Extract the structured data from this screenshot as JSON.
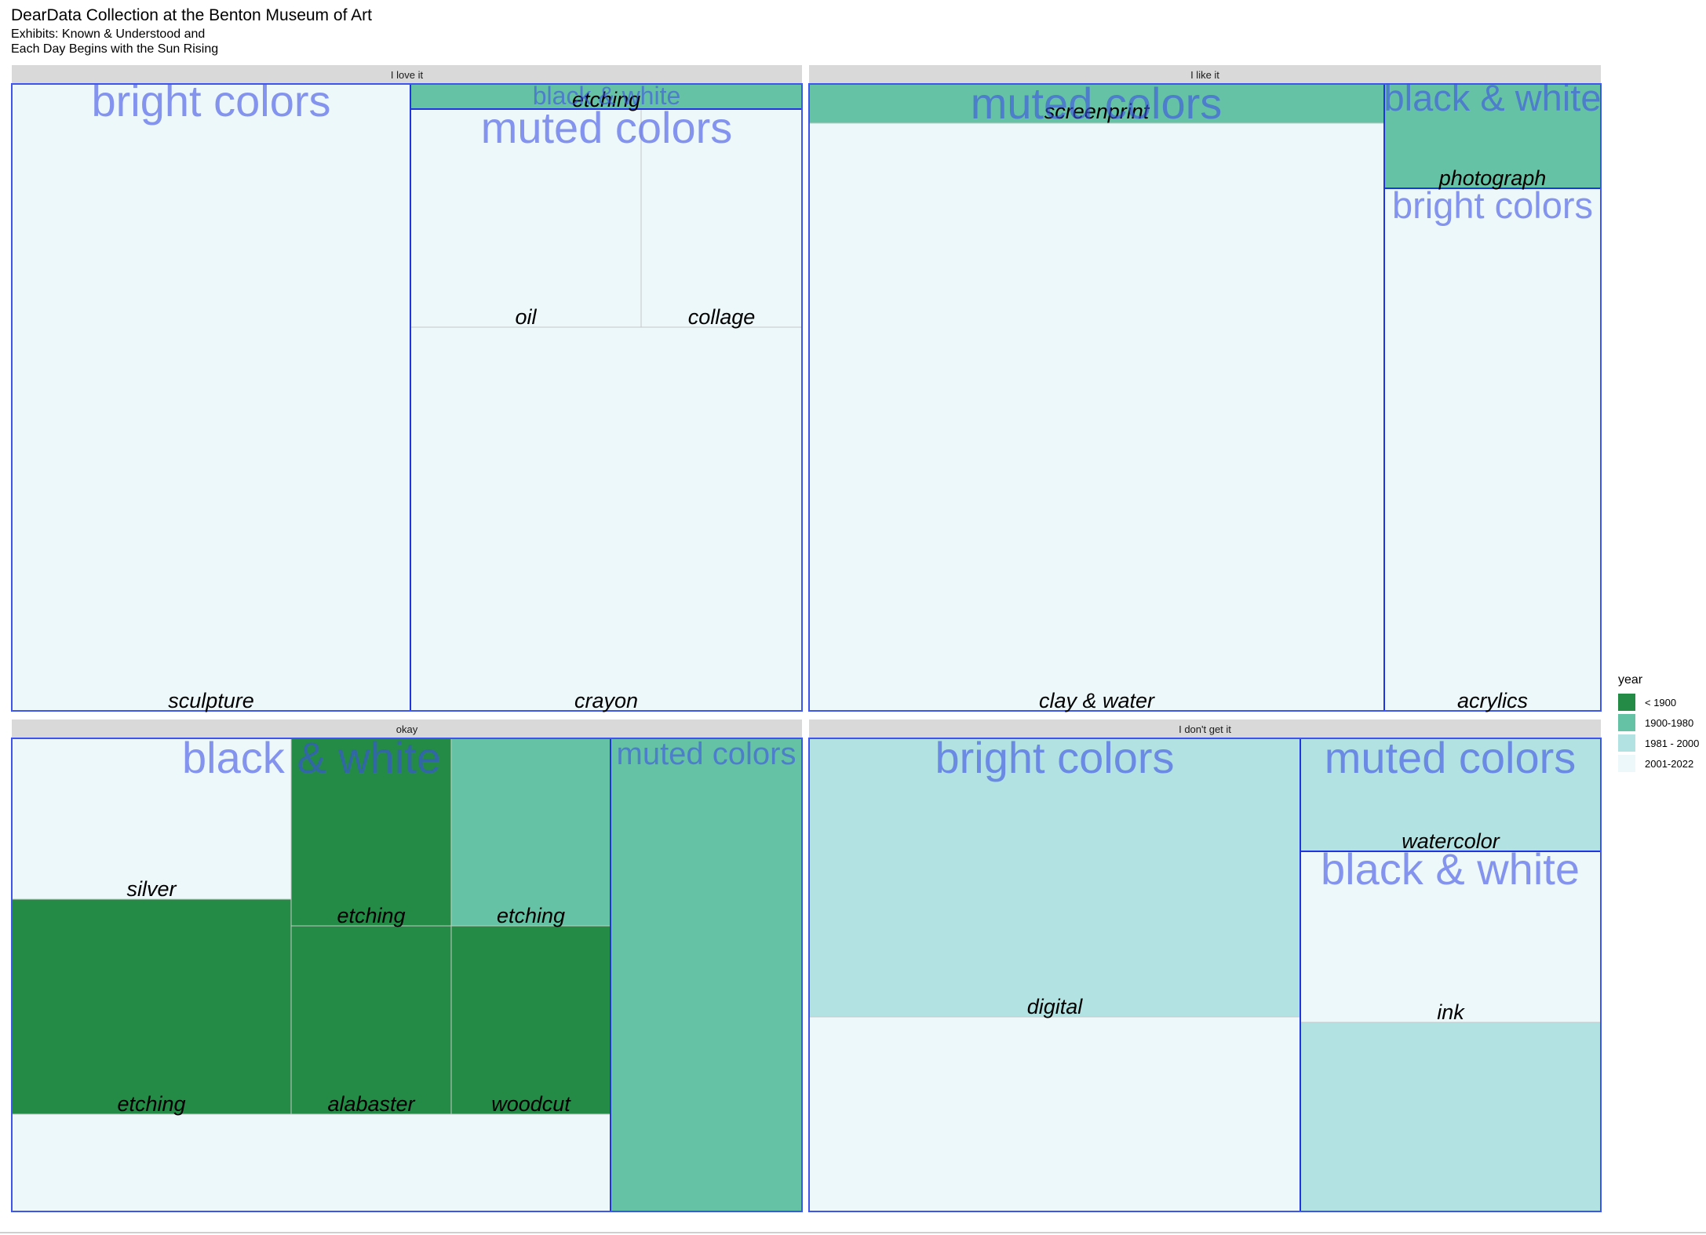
{
  "chart_data": {
    "type": "treemap",
    "title": "DearData Collection at the Benton Museum of Art",
    "subtitle_lines": [
      "Exhibits: Known & Understood and",
      "Each Day Begins with the Sun Rising"
    ],
    "legend": {
      "title": "year",
      "position": "right",
      "items": [
        {
          "label": "< 1900",
          "color": "#238b45"
        },
        {
          "label": "1900-1980",
          "color": "#66c2a4"
        },
        {
          "label": "1981 - 2000",
          "color": "#b2e2e2"
        },
        {
          "label": "2001-2022",
          "color": "#edf8fb"
        }
      ]
    },
    "facets": [
      {
        "name": "I love it",
        "groups": [
          {
            "name": "bright colors",
            "items": [
              {
                "label": "sculpture",
                "area_share": 0.502,
                "era": "2001-2022"
              }
            ]
          },
          {
            "name": "black & white",
            "items": [
              {
                "label": "etching",
                "area_share": 0.02,
                "era": "1900-1980"
              }
            ]
          },
          {
            "name": "muted colors",
            "items": [
              {
                "label": "oil",
                "area_share": 0.168,
                "era": "2001-2022"
              },
              {
                "label": "collage",
                "area_share": 0.116,
                "era": "2001-2022"
              },
              {
                "label": "crayon",
                "area_share": 0.3,
                "era": "2001-2022"
              }
            ]
          }
        ]
      },
      {
        "name": "I like it",
        "groups": [
          {
            "name": "muted colors",
            "items": [
              {
                "label": "screenprint",
                "area_share": 0.044,
                "era": "1900-1980"
              },
              {
                "label": "clay & water",
                "area_share": 0.684,
                "era": "2001-2022"
              }
            ]
          },
          {
            "name": "black & white",
            "items": [
              {
                "label": "photograph",
                "area_share": 0.044,
                "era": "1900-1980"
              }
            ]
          },
          {
            "name": "bright colors",
            "items": [
              {
                "label": "acrylics",
                "area_share": 0.228,
                "era": "2001-2022"
              }
            ]
          }
        ]
      },
      {
        "name": "okay",
        "groups": [
          {
            "name": "black & white",
            "items": [
              {
                "label": "silver",
                "area_share": 0.136,
                "era": "2001-2022"
              },
              {
                "label": "etching",
                "area_share": 0.092,
                "era": "< 1900"
              },
              {
                "label": "etching",
                "area_share": 0.07,
                "era": "< 1900"
              },
              {
                "label": "etching",
                "area_share": 0.07,
                "era": "1900-1980"
              },
              {
                "label": "alabaster",
                "area_share": 0.055,
                "era": "< 1900"
              },
              {
                "label": "woodcut",
                "area_share": 0.055,
                "era": "< 1900"
              },
              {
                "label": "",
                "area_share": 0.279,
                "era": "2001-2022"
              }
            ]
          },
          {
            "name": "muted colors",
            "items": [
              {
                "label": "",
                "area_share": 0.243,
                "era": "1900-1980"
              }
            ]
          }
        ]
      },
      {
        "name": "I don't get it",
        "groups": [
          {
            "name": "bright colors",
            "items": [
              {
                "label": "digital",
                "area_share": 0.378,
                "era": "1981 - 2000"
              },
              {
                "label": "",
                "area_share": 0.237,
                "era": "2001-2022"
              }
            ]
          },
          {
            "name": "muted colors",
            "items": [
              {
                "label": "watercolor",
                "area_share": 0.084,
                "era": "1981 - 2000"
              }
            ]
          },
          {
            "name": "black & white",
            "items": [
              {
                "label": "ink",
                "area_share": 0.127,
                "era": "2001-2022"
              },
              {
                "label": "",
                "area_share": 0.174,
                "era": "1981 - 2000"
              }
            ]
          }
        ]
      }
    ]
  }
}
